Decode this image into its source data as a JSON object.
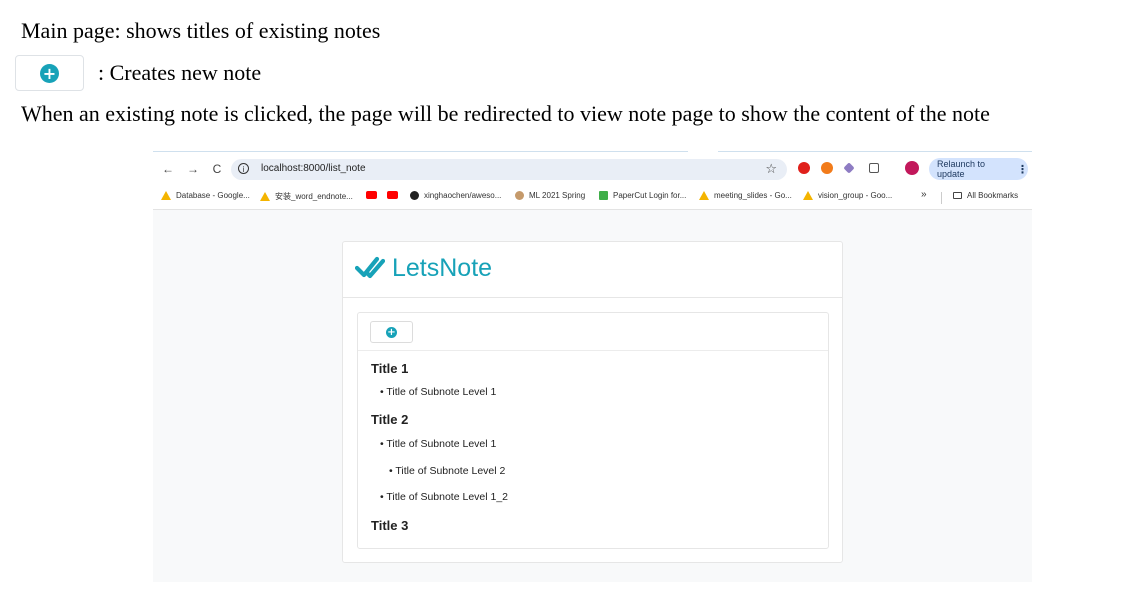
{
  "doc": {
    "line1": "Main page: shows titles of existing notes",
    "line2": ": Creates new note",
    "line3": "When an existing note is clicked, the page will be redirected to view note page to show the content of the note"
  },
  "browser": {
    "nav": {
      "back": "←",
      "forward": "→",
      "reload": "C"
    },
    "url": "localhost:8000/list_note",
    "relaunch_label": "Relaunch to update",
    "relaunch_menu": "⋮",
    "bookmarks": [
      {
        "label": "Database - Google...",
        "icon": "drive-icon"
      },
      {
        "label": "安装_word_endnote...",
        "icon": "drive-icon"
      },
      {
        "label": "",
        "icon": "youtube-icon"
      },
      {
        "label": "",
        "icon": "youtube-icon"
      },
      {
        "label": "xinghaochen/aweso...",
        "icon": "github-icon"
      },
      {
        "label": "ML 2021 Spring",
        "icon": "ml-icon"
      },
      {
        "label": "PaperCut Login for...",
        "icon": "papercut-icon"
      },
      {
        "label": "meeting_slides - Go...",
        "icon": "drive-icon"
      },
      {
        "label": "vision_group - Goo...",
        "icon": "drive-icon"
      }
    ],
    "more_bookmarks": "»",
    "all_bookmarks": "All Bookmarks"
  },
  "app": {
    "brand": "LetsNote",
    "accent_color": "#17a2b8",
    "notes": [
      {
        "title": "Title 1",
        "subnotes": [
          {
            "label": "• Title of Subnote Level 1"
          }
        ]
      },
      {
        "title": "Title 2",
        "subnotes": [
          {
            "label": "• Title of Subnote Level 1"
          },
          {
            "label": "• Title of Subnote Level 2"
          },
          {
            "label": "• Title of Subnote Level 1_2"
          }
        ]
      },
      {
        "title": "Title 3",
        "subnotes": []
      }
    ]
  }
}
